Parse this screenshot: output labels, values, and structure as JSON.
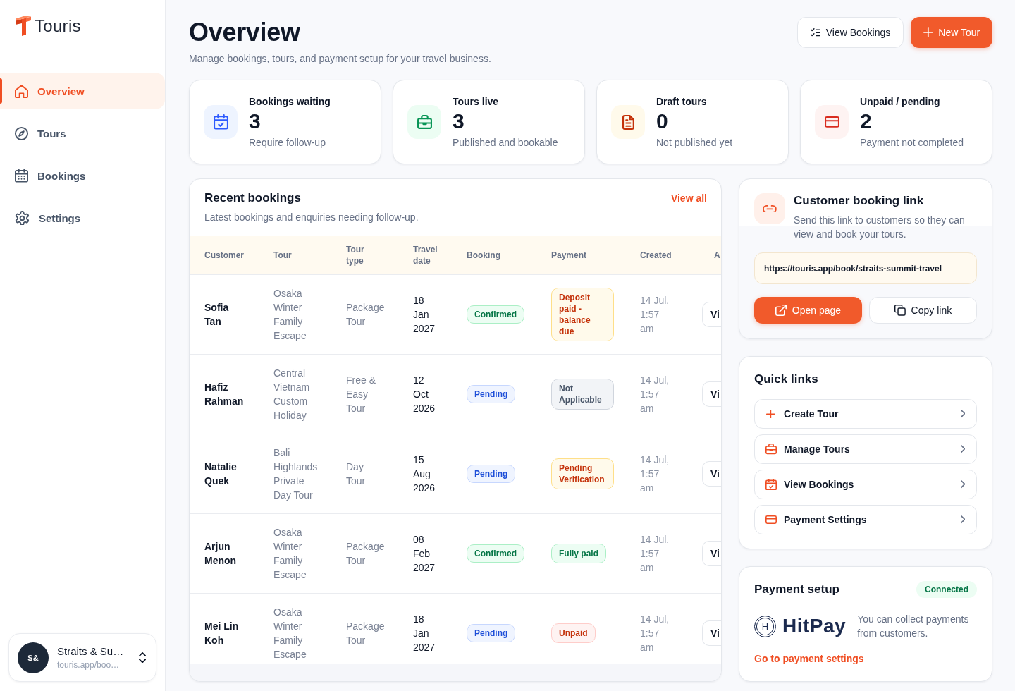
{
  "app": {
    "name": "Touris"
  },
  "sidebar": {
    "items": [
      {
        "label": "Overview",
        "selected": true
      },
      {
        "label": "Tours",
        "selected": false
      },
      {
        "label": "Bookings",
        "selected": false
      },
      {
        "label": "Settings",
        "selected": false
      }
    ]
  },
  "account": {
    "initials": "S&",
    "name": "Straits & Su…",
    "subtitle": "touris.app/boo…"
  },
  "header": {
    "title": "Overview",
    "subtitle": "Manage bookings, tours, and payment setup for your travel business.",
    "buttons": [
      {
        "label": "View Bookings",
        "kind": "secondary"
      },
      {
        "label": "New Tour",
        "kind": "primary"
      }
    ]
  },
  "stats": [
    {
      "label": "Bookings waiting",
      "value": "3",
      "caption": "Require follow-up"
    },
    {
      "label": "Tours live",
      "value": "3",
      "caption": "Published and bookable"
    },
    {
      "label": "Draft tours",
      "value": "0",
      "caption": "Not published yet"
    },
    {
      "label": "Unpaid / pending",
      "value": "2",
      "caption": "Payment not completed"
    }
  ],
  "recent_bookings": {
    "title": "Recent bookings",
    "link": "View all",
    "subtitle": "Latest bookings and enquiries needing follow-up.",
    "table": {
      "columns": [
        "Customer",
        "Tour",
        "Tour type",
        "Travel date",
        "Booking",
        "Payment",
        "Created",
        "A"
      ],
      "rows": [
        {
          "customer": "Sofia Tan",
          "tour": "Osaka Winter Family Escape",
          "tour_type": "Package Tour",
          "travel_date": "18 Jan 2027",
          "booking": {
            "text": "Confirmed",
            "kind": "success"
          },
          "payment": {
            "text": "Deposit paid - balance due",
            "kind": "warning"
          },
          "created": "14 Jul, 1:57 am",
          "action": "Vi"
        },
        {
          "customer": "Hafiz Rahman",
          "tour": "Central Vietnam Custom Holiday",
          "tour_type": "Free & Easy Tour",
          "travel_date": "12 Oct 2026",
          "booking": {
            "text": "Pending",
            "kind": "info"
          },
          "payment": {
            "text": "Not Applicable",
            "kind": "neutral"
          },
          "created": "14 Jul, 1:57 am",
          "action": "Vi"
        },
        {
          "customer": "Natalie Quek",
          "tour": "Bali Highlands Private Day Tour",
          "tour_type": "Day Tour",
          "travel_date": "15 Aug 2026",
          "booking": {
            "text": "Pending",
            "kind": "info"
          },
          "payment": {
            "text": "Pending Verification",
            "kind": "warning"
          },
          "created": "14 Jul, 1:57 am",
          "action": "Vi"
        },
        {
          "customer": "Arjun Menon",
          "tour": "Osaka Winter Family Escape",
          "tour_type": "Package Tour",
          "travel_date": "08 Feb 2027",
          "booking": {
            "text": "Confirmed",
            "kind": "success"
          },
          "payment": {
            "text": "Fully paid",
            "kind": "success"
          },
          "created": "14 Jul, 1:57 am",
          "action": "Vi"
        },
        {
          "customer": "Mei Lin Koh",
          "tour": "Osaka Winter Family Escape",
          "tour_type": "Package Tour",
          "travel_date": "18 Jan 2027",
          "booking": {
            "text": "Pending",
            "kind": "info"
          },
          "payment": {
            "text": "Unpaid",
            "kind": "danger"
          },
          "created": "14 Jul, 1:57 am",
          "action": "Vi"
        }
      ]
    }
  },
  "booking_link": {
    "title": "Customer booking link",
    "description": "Send this link to customers so they can view and book your tours.",
    "url": "https://touris.app/book/straits-summit-travel",
    "buttons": [
      {
        "label": "Open page",
        "kind": "primary"
      },
      {
        "label": "Copy link",
        "kind": "secondary"
      }
    ]
  },
  "quick_links": {
    "title": "Quick links",
    "items": [
      {
        "label": "Create Tour"
      },
      {
        "label": "Manage Tours"
      },
      {
        "label": "View Bookings"
      },
      {
        "label": "Payment Settings"
      }
    ]
  },
  "payment_setup": {
    "title": "Payment setup",
    "status": "Connected",
    "provider": {
      "mark": "H",
      "name": "HitPay"
    },
    "description": "You can collect payments from customers.",
    "link": "Go to payment settings"
  }
}
